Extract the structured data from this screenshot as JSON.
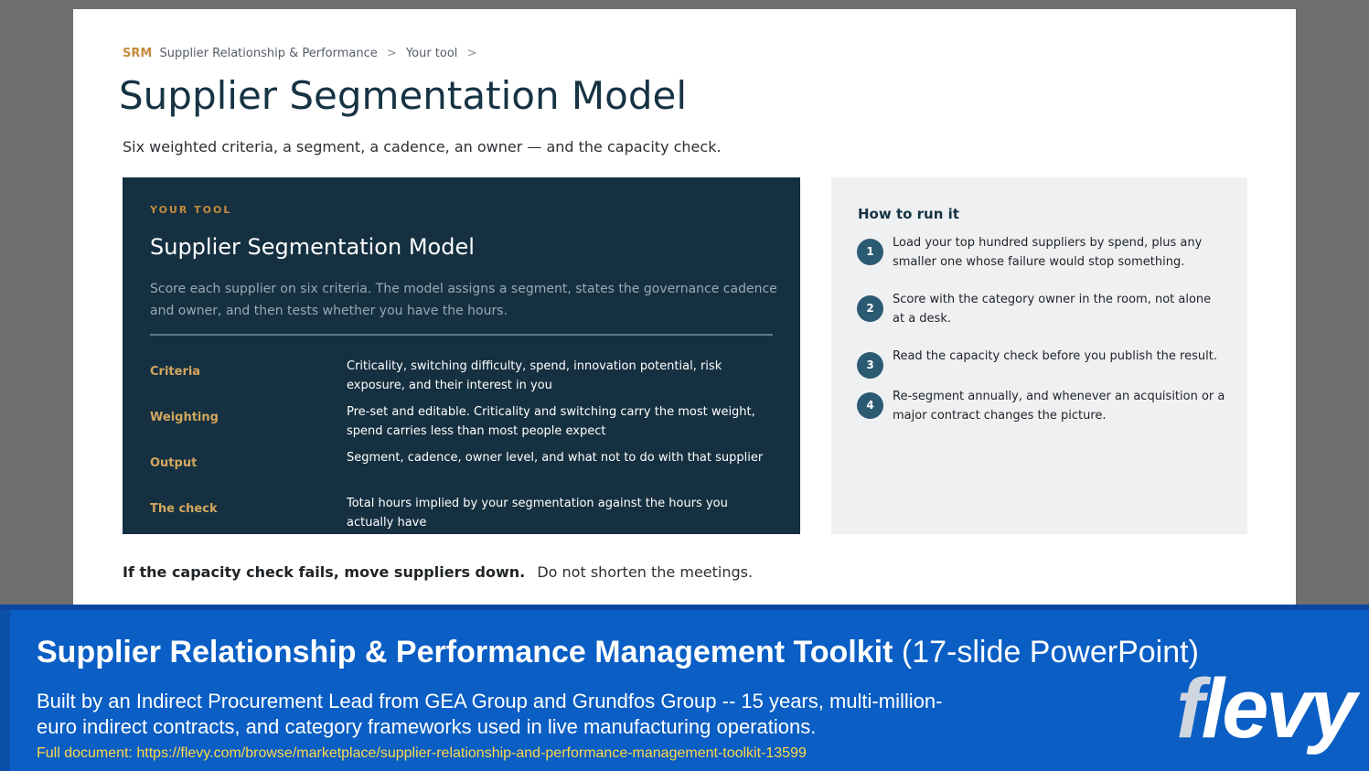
{
  "breadcrumb": {
    "section_code": "SRM",
    "section": "Supplier Relationship & Performance",
    "page": "Your tool",
    "separator": ">"
  },
  "page": {
    "title": "Supplier Segmentation Model",
    "subtitle": "Six weighted criteria, a segment, a cadence, an owner — and the capacity check."
  },
  "tool": {
    "tag": "YOUR TOOL",
    "title": "Supplier Segmentation Model",
    "description": "Score each supplier on six criteria. The model assigns a segment, states the governance cadence and owner, and then tests whether you have the hours.",
    "rows": [
      {
        "label": "Criteria",
        "value": "Criticality, switching difficulty, spend, innovation potential, risk exposure, and their interest in you"
      },
      {
        "label": "Weighting",
        "value": "Pre-set and editable. Criticality and switching carry the most weight, spend carries less than most people expect"
      },
      {
        "label": "Output",
        "value": "Segment, cadence, owner level, and what not to do with that supplier"
      },
      {
        "label": "The check",
        "value": "Total hours implied by your segmentation against the hours you actually have"
      }
    ]
  },
  "howto": {
    "title": "How to run it",
    "steps": [
      {
        "num": "1",
        "text": "Load your top hundred suppliers by spend, plus any smaller one whose failure would stop something."
      },
      {
        "num": "2",
        "text": "Score with the category owner in the room, not alone at a desk."
      },
      {
        "num": "3",
        "text": "Read the capacity check before you publish the result."
      },
      {
        "num": "4",
        "text": "Re-segment annually, and whenever an acquisition or a major contract changes the picture."
      }
    ]
  },
  "footnote": {
    "bold": "If the capacity check fails, move suppliers down.",
    "rest": "Do not shorten the meetings."
  },
  "banner": {
    "title": "Supplier Relationship & Performance Management Toolkit",
    "title_suffix": "(17-slide PowerPoint)",
    "description": "Built by an Indirect Procurement Lead from GEA Group and Grundfos Group -- 15 years, multi-million-euro indirect contracts, and category frameworks used in live manufacturing operations.",
    "link": "Full document: https://flevy.com/browse/marketplace/supplier-relationship-and-performance-management-toolkit-13599",
    "brand_first": "f",
    "brand_rest": "levy"
  },
  "colors": {
    "navy": "#163344",
    "panel_dark": "#153040",
    "accent_gold": "#c48a3c",
    "label_gold": "#d3a75f",
    "step_circle": "#2b5a73",
    "banner_blue": "#0a5ec4",
    "link_yellow": "#ffd84a"
  }
}
